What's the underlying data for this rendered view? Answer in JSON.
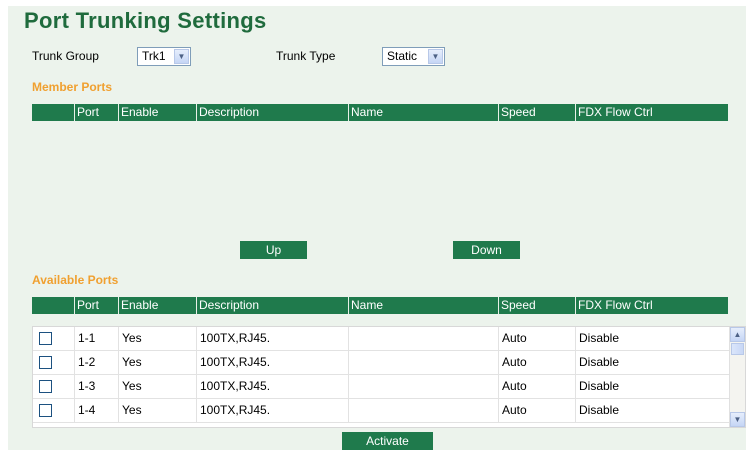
{
  "title": "Port Trunking Settings",
  "trunk_group": {
    "label": "Trunk Group",
    "value": "Trk1"
  },
  "trunk_type": {
    "label": "Trunk Type",
    "value": "Static"
  },
  "member_ports": {
    "heading": "Member Ports",
    "columns": [
      "Port",
      "Enable",
      "Description",
      "Name",
      "Speed",
      "FDX Flow Ctrl"
    ]
  },
  "buttons": {
    "up": "Up",
    "down": "Down",
    "activate": "Activate"
  },
  "available_ports": {
    "heading": "Available Ports",
    "columns": [
      "Port",
      "Enable",
      "Description",
      "Name",
      "Speed",
      "FDX Flow Ctrl"
    ],
    "rows": [
      {
        "port": "1-1",
        "enable": "Yes",
        "description": "100TX,RJ45.",
        "name": "",
        "speed": "Auto",
        "fdx": "Disable"
      },
      {
        "port": "1-2",
        "enable": "Yes",
        "description": "100TX,RJ45.",
        "name": "",
        "speed": "Auto",
        "fdx": "Disable"
      },
      {
        "port": "1-3",
        "enable": "Yes",
        "description": "100TX,RJ45.",
        "name": "",
        "speed": "Auto",
        "fdx": "Disable"
      },
      {
        "port": "1-4",
        "enable": "Yes",
        "description": "100TX,RJ45.",
        "name": "",
        "speed": "Auto",
        "fdx": "Disable"
      }
    ]
  },
  "colors": {
    "title": "#1f6b3d",
    "header_bg": "#1f7a4c",
    "section": "#f0a030",
    "panel_bg": "#ecf3ec"
  },
  "icons": {
    "select_arrow": "chevron-down-icon",
    "checkbox": "checkbox-icon"
  }
}
